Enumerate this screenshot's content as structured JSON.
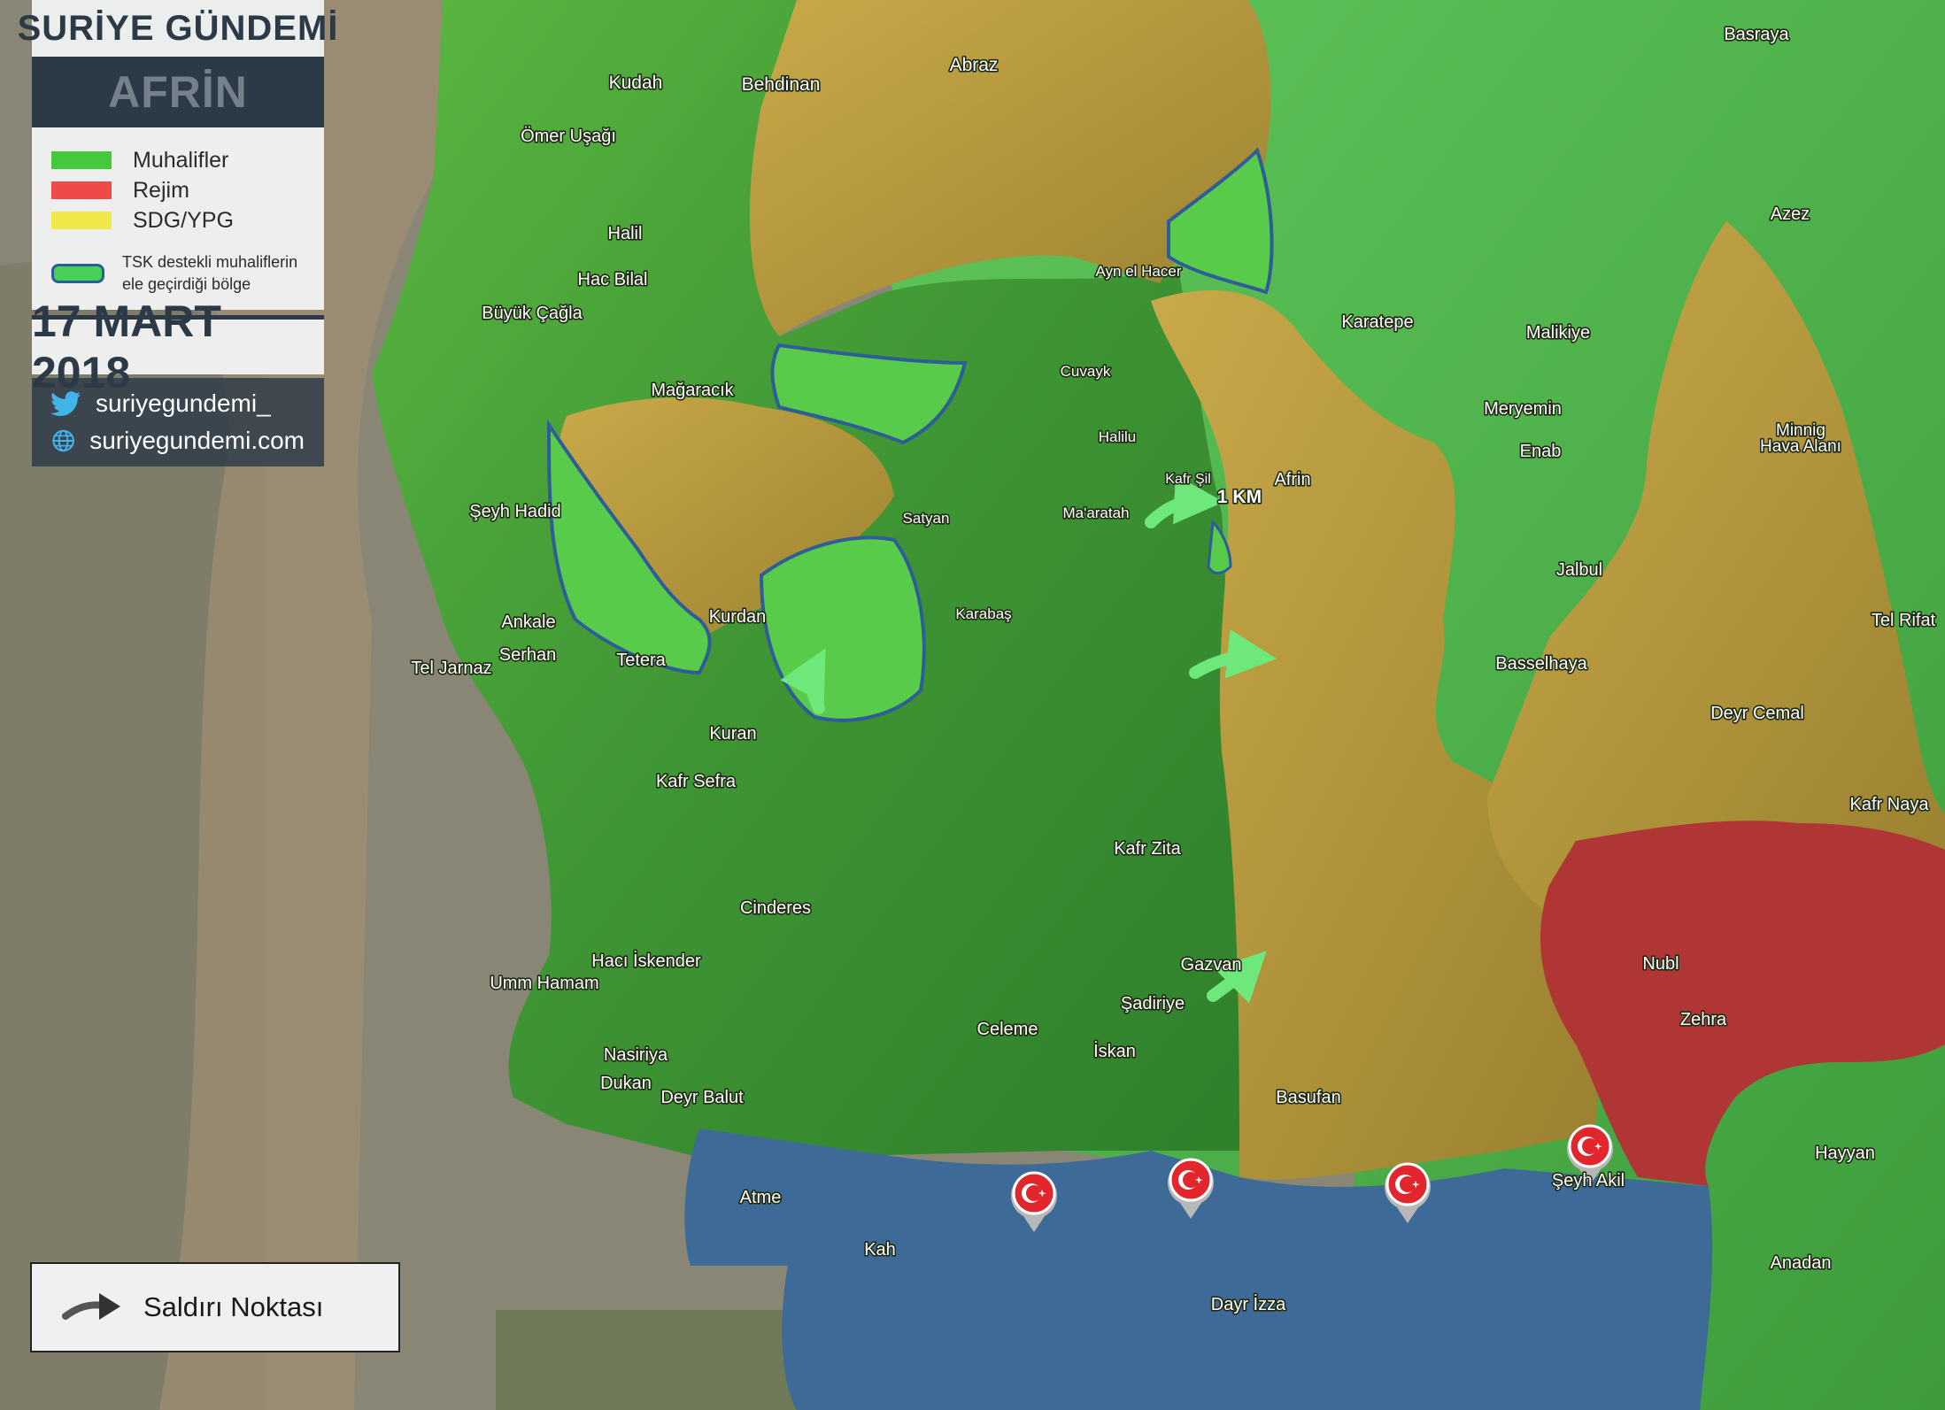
{
  "header": {
    "brand_word1": "SURİYE",
    "brand_word2": "GÜNDEMİ",
    "region": "AFRİN",
    "date": "17 MART 2018"
  },
  "legend": {
    "items": [
      {
        "label": "Muhalifler",
        "color": "#44c93c"
      },
      {
        "label": "Rejim",
        "color": "#ef4a4a"
      },
      {
        "label": "SDG/YPG",
        "color": "#f0e84a"
      }
    ],
    "tsk_line1": "TSK destekli muhaliflerin",
    "tsk_line2": "ele geçirdiği bölge",
    "tsk_fill": "#48cf55",
    "tsk_border": "#2f5d97"
  },
  "social": {
    "twitter_handle": "suriyegundemi_",
    "website": "suriyegundemi.com"
  },
  "attack_legend": {
    "label": "Saldırı Noktası"
  },
  "map": {
    "distance_label": "1 KM",
    "zone_colors": {
      "opposition": "#4aa03a",
      "regime": "#b03636",
      "sdg_ypg": "#b59638",
      "turkey_controlled": "#3d6a96",
      "captured": "#58cc4a"
    },
    "places": [
      "Kudah",
      "Behdinan",
      "Abraz",
      "Basraya",
      "Ömer Uşağı",
      "Halil",
      "Hac Bilal",
      "Büyük Çağla",
      "Azez",
      "Ayn el Hacer",
      "Karatepe",
      "Malikiye",
      "Mağaracık",
      "Cuvayk",
      "Meryemin",
      "Minnig",
      "Hava Alanı",
      "Halilu",
      "Kafr Şil",
      "Afrin",
      "Enab",
      "Şeyh Hadid",
      "Satyan",
      "Ma'aratah",
      "Jalbul",
      "Ankale",
      "Karabaş",
      "Kurdan",
      "Tel Rifat",
      "Serhan",
      "Tetera",
      "Tel Jarnaz",
      "Basselhaya",
      "Kuran",
      "Deyr Cemal",
      "Kafr Sefra",
      "Kafr Naya",
      "Kafr Zita",
      "Cinderes",
      "Nubl",
      "Hacı İskender",
      "Gazvan",
      "Umm Hamam",
      "Şadiriye",
      "Zehra",
      "Celeme",
      "İskan",
      "Nasiriya",
      "Dukan",
      "Deyr Balut",
      "Basufan",
      "Hayyan",
      "Şeyh Akil",
      "Atme",
      "Kah",
      "Anadan",
      "Dayr İzza"
    ]
  }
}
